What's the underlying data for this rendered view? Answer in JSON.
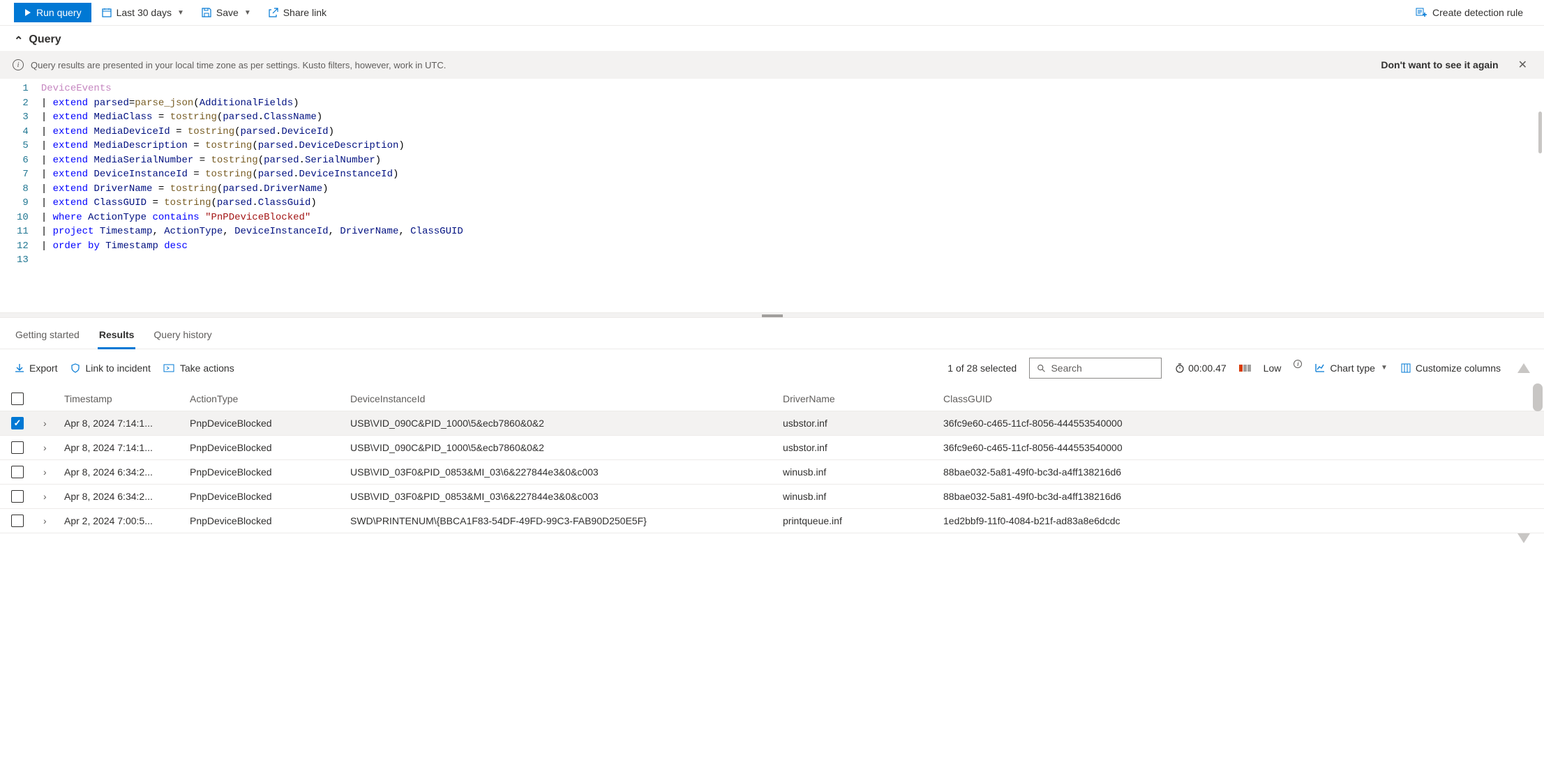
{
  "toolbar": {
    "run": "Run query",
    "timerange": "Last 30 days",
    "save": "Save",
    "share": "Share link",
    "create_rule": "Create detection rule"
  },
  "query_section": {
    "title": "Query"
  },
  "info_bar": {
    "message": "Query results are presented in your local time zone as per settings. Kusto filters, however, work in UTC.",
    "dismiss": "Don't want to see it again"
  },
  "editor": {
    "lines": [
      {
        "n": 1,
        "segs": [
          [
            "DeviceEvents",
            "tk-tbl"
          ]
        ]
      },
      {
        "n": 2,
        "segs": [
          [
            "| ",
            "tk-pipe"
          ],
          [
            "extend",
            "tk-kw"
          ],
          [
            " parsed",
            "tk-var"
          ],
          [
            "=",
            "tk-op"
          ],
          [
            "parse_json",
            "tk-fn"
          ],
          [
            "(",
            "tk-op"
          ],
          [
            "AdditionalFields",
            "tk-var"
          ],
          [
            ")",
            "tk-op"
          ]
        ]
      },
      {
        "n": 3,
        "segs": [
          [
            "| ",
            "tk-pipe"
          ],
          [
            "extend",
            "tk-kw"
          ],
          [
            " MediaClass ",
            "tk-var"
          ],
          [
            "= ",
            "tk-op"
          ],
          [
            "tostring",
            "tk-fn"
          ],
          [
            "(",
            "tk-op"
          ],
          [
            "parsed",
            "tk-var"
          ],
          [
            ".",
            "tk-dot"
          ],
          [
            "ClassName",
            "tk-var"
          ],
          [
            ")",
            "tk-op"
          ]
        ]
      },
      {
        "n": 4,
        "segs": [
          [
            "| ",
            "tk-pipe"
          ],
          [
            "extend",
            "tk-kw"
          ],
          [
            " MediaDeviceId ",
            "tk-var"
          ],
          [
            "= ",
            "tk-op"
          ],
          [
            "tostring",
            "tk-fn"
          ],
          [
            "(",
            "tk-op"
          ],
          [
            "parsed",
            "tk-var"
          ],
          [
            ".",
            "tk-dot"
          ],
          [
            "DeviceId",
            "tk-var"
          ],
          [
            ")",
            "tk-op"
          ]
        ]
      },
      {
        "n": 5,
        "segs": [
          [
            "| ",
            "tk-pipe"
          ],
          [
            "extend",
            "tk-kw"
          ],
          [
            " MediaDescription ",
            "tk-var"
          ],
          [
            "= ",
            "tk-op"
          ],
          [
            "tostring",
            "tk-fn"
          ],
          [
            "(",
            "tk-op"
          ],
          [
            "parsed",
            "tk-var"
          ],
          [
            ".",
            "tk-dot"
          ],
          [
            "DeviceDescription",
            "tk-var"
          ],
          [
            ")",
            "tk-op"
          ]
        ]
      },
      {
        "n": 6,
        "segs": [
          [
            "| ",
            "tk-pipe"
          ],
          [
            "extend",
            "tk-kw"
          ],
          [
            " MediaSerialNumber ",
            "tk-var"
          ],
          [
            "= ",
            "tk-op"
          ],
          [
            "tostring",
            "tk-fn"
          ],
          [
            "(",
            "tk-op"
          ],
          [
            "parsed",
            "tk-var"
          ],
          [
            ".",
            "tk-dot"
          ],
          [
            "SerialNumber",
            "tk-var"
          ],
          [
            ")",
            "tk-op"
          ]
        ]
      },
      {
        "n": 7,
        "segs": [
          [
            "| ",
            "tk-pipe"
          ],
          [
            "extend",
            "tk-kw"
          ],
          [
            " DeviceInstanceId ",
            "tk-var"
          ],
          [
            "= ",
            "tk-op"
          ],
          [
            "tostring",
            "tk-fn"
          ],
          [
            "(",
            "tk-op"
          ],
          [
            "parsed",
            "tk-var"
          ],
          [
            ".",
            "tk-dot"
          ],
          [
            "DeviceInstanceId",
            "tk-var"
          ],
          [
            ")",
            "tk-op"
          ]
        ]
      },
      {
        "n": 8,
        "segs": [
          [
            "| ",
            "tk-pipe"
          ],
          [
            "extend",
            "tk-kw"
          ],
          [
            " DriverName ",
            "tk-var"
          ],
          [
            "= ",
            "tk-op"
          ],
          [
            "tostring",
            "tk-fn"
          ],
          [
            "(",
            "tk-op"
          ],
          [
            "parsed",
            "tk-var"
          ],
          [
            ".",
            "tk-dot"
          ],
          [
            "DriverName",
            "tk-var"
          ],
          [
            ")",
            "tk-op"
          ]
        ]
      },
      {
        "n": 9,
        "segs": [
          [
            "| ",
            "tk-pipe"
          ],
          [
            "extend",
            "tk-kw"
          ],
          [
            " ClassGUID ",
            "tk-var"
          ],
          [
            "= ",
            "tk-op"
          ],
          [
            "tostring",
            "tk-fn"
          ],
          [
            "(",
            "tk-op"
          ],
          [
            "parsed",
            "tk-var"
          ],
          [
            ".",
            "tk-dot"
          ],
          [
            "ClassGuid",
            "tk-var"
          ],
          [
            ")",
            "tk-op"
          ]
        ]
      },
      {
        "n": 10,
        "segs": [
          [
            "| ",
            "tk-pipe"
          ],
          [
            "where",
            "tk-kw"
          ],
          [
            " ActionType ",
            "tk-var"
          ],
          [
            "contains",
            "tk-kw"
          ],
          [
            " ",
            "tk-op"
          ],
          [
            "\"PnPDeviceBlocked\"",
            "tk-str"
          ]
        ]
      },
      {
        "n": 11,
        "segs": [
          [
            "| ",
            "tk-pipe"
          ],
          [
            "project",
            "tk-kw"
          ],
          [
            " Timestamp",
            "tk-var"
          ],
          [
            ", ",
            "tk-op"
          ],
          [
            "ActionType",
            "tk-var"
          ],
          [
            ", ",
            "tk-op"
          ],
          [
            "DeviceInstanceId",
            "tk-var"
          ],
          [
            ", ",
            "tk-op"
          ],
          [
            "DriverName",
            "tk-var"
          ],
          [
            ", ",
            "tk-op"
          ],
          [
            "ClassGUID",
            "tk-var"
          ]
        ]
      },
      {
        "n": 12,
        "segs": [
          [
            "| ",
            "tk-pipe"
          ],
          [
            "order",
            "tk-kw"
          ],
          [
            " ",
            "tk-op"
          ],
          [
            "by",
            "tk-by"
          ],
          [
            " Timestamp ",
            "tk-var"
          ],
          [
            "desc",
            "tk-kw"
          ]
        ]
      },
      {
        "n": 13,
        "segs": []
      }
    ]
  },
  "tabs": {
    "getting_started": "Getting started",
    "results": "Results",
    "history": "Query history"
  },
  "results_bar": {
    "export": "Export",
    "link_incident": "Link to incident",
    "take_actions": "Take actions",
    "selected": "1 of 28 selected",
    "search_placeholder": "Search",
    "elapsed": "00:00.47",
    "resource": "Low",
    "chart_type": "Chart type",
    "customize": "Customize columns"
  },
  "grid": {
    "headers": {
      "ts": "Timestamp",
      "action": "ActionType",
      "device": "DeviceInstanceId",
      "driver": "DriverName",
      "guid": "ClassGUID"
    },
    "rows": [
      {
        "checked": true,
        "ts": "Apr 8, 2024 7:14:1...",
        "action": "PnpDeviceBlocked",
        "device": "USB\\VID_090C&PID_1000\\5&ecb7860&0&2",
        "driver": "usbstor.inf",
        "guid": "36fc9e60-c465-11cf-8056-444553540000"
      },
      {
        "checked": false,
        "ts": "Apr 8, 2024 7:14:1...",
        "action": "PnpDeviceBlocked",
        "device": "USB\\VID_090C&PID_1000\\5&ecb7860&0&2",
        "driver": "usbstor.inf",
        "guid": "36fc9e60-c465-11cf-8056-444553540000"
      },
      {
        "checked": false,
        "ts": "Apr 8, 2024 6:34:2...",
        "action": "PnpDeviceBlocked",
        "device": "USB\\VID_03F0&PID_0853&MI_03\\6&227844e3&0&c003",
        "driver": "winusb.inf",
        "guid": "88bae032-5a81-49f0-bc3d-a4ff138216d6"
      },
      {
        "checked": false,
        "ts": "Apr 8, 2024 6:34:2...",
        "action": "PnpDeviceBlocked",
        "device": "USB\\VID_03F0&PID_0853&MI_03\\6&227844e3&0&c003",
        "driver": "winusb.inf",
        "guid": "88bae032-5a81-49f0-bc3d-a4ff138216d6"
      },
      {
        "checked": false,
        "ts": "Apr 2, 2024 7:00:5...",
        "action": "PnpDeviceBlocked",
        "device": "SWD\\PRINTENUM\\{BBCA1F83-54DF-49FD-99C3-FAB90D250E5F}",
        "driver": "printqueue.inf",
        "guid": "1ed2bbf9-11f0-4084-b21f-ad83a8e6dcdc"
      }
    ]
  }
}
